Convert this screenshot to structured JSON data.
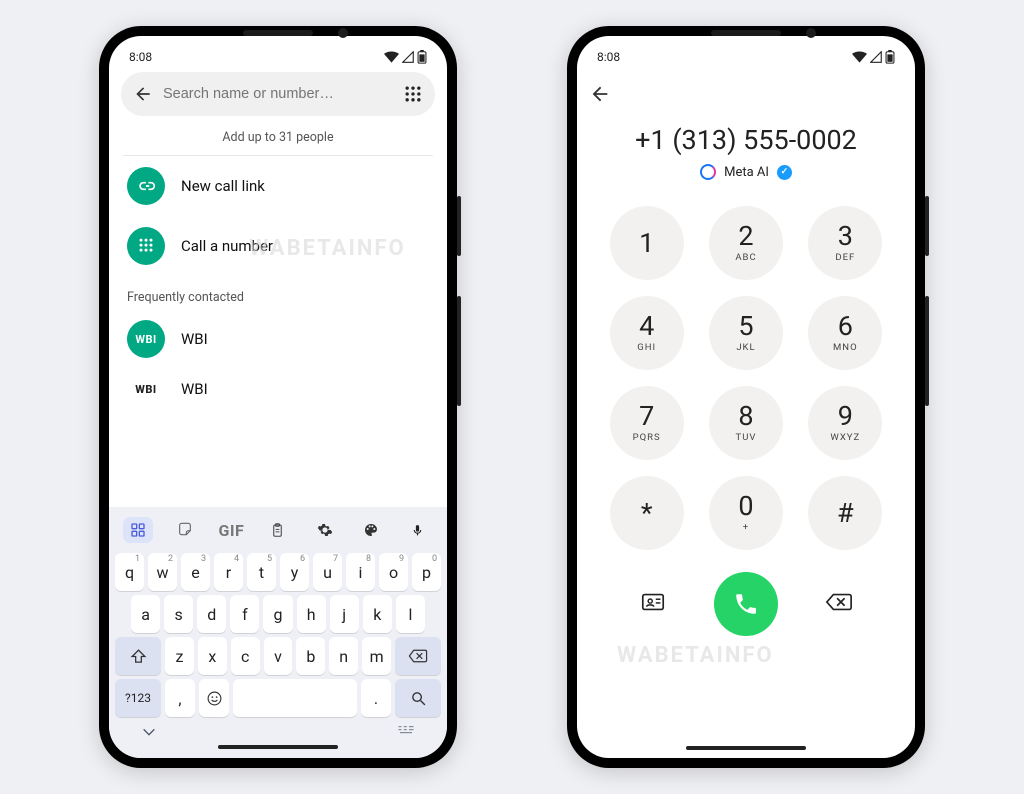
{
  "status": {
    "time": "8:08"
  },
  "left": {
    "search_placeholder": "Search name or number…",
    "hint": "Add up to 31 people",
    "items": {
      "new_link": "New call link",
      "call_number": "Call a number"
    },
    "frequent_header": "Frequently contacted",
    "contacts": [
      {
        "avatar": "WBI",
        "name": "WBI"
      },
      {
        "avatar": "WBI",
        "name": "WBI"
      }
    ],
    "toolbar": {
      "gif": "GIF"
    },
    "keyboard": {
      "row1": [
        {
          "k": "q",
          "s": "1"
        },
        {
          "k": "w",
          "s": "2"
        },
        {
          "k": "e",
          "s": "3"
        },
        {
          "k": "r",
          "s": "4"
        },
        {
          "k": "t",
          "s": "5"
        },
        {
          "k": "y",
          "s": "6"
        },
        {
          "k": "u",
          "s": "7"
        },
        {
          "k": "i",
          "s": "8"
        },
        {
          "k": "o",
          "s": "9"
        },
        {
          "k": "p",
          "s": "0"
        }
      ],
      "row2": [
        "a",
        "s",
        "d",
        "f",
        "g",
        "h",
        "j",
        "k",
        "l"
      ],
      "row3": [
        "z",
        "x",
        "c",
        "v",
        "b",
        "n",
        "m"
      ],
      "sym": "?123",
      "comma": ",",
      "period": "."
    }
  },
  "right": {
    "number": "+1 (313) 555-0002",
    "meta_label": "Meta AI",
    "keys": [
      {
        "n": "1",
        "l": ""
      },
      {
        "n": "2",
        "l": "ABC"
      },
      {
        "n": "3",
        "l": "DEF"
      },
      {
        "n": "4",
        "l": "GHI"
      },
      {
        "n": "5",
        "l": "JKL"
      },
      {
        "n": "6",
        "l": "MNO"
      },
      {
        "n": "7",
        "l": "PQRS"
      },
      {
        "n": "8",
        "l": "TUV"
      },
      {
        "n": "9",
        "l": "WXYZ"
      },
      {
        "n": "*",
        "l": ""
      },
      {
        "n": "0",
        "l": "+"
      },
      {
        "n": "#",
        "l": ""
      }
    ]
  },
  "watermark": "WABETAINFO"
}
